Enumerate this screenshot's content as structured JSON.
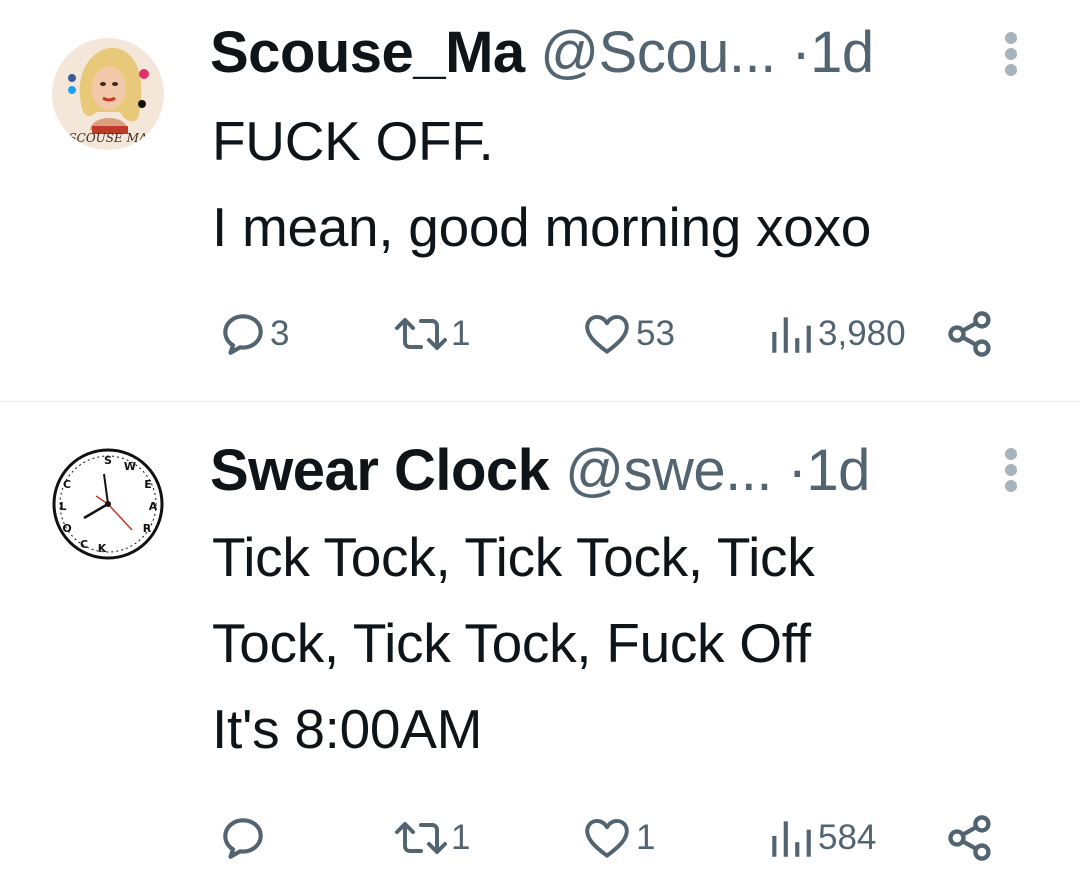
{
  "tweets": [
    {
      "name": "Scouse_Ma",
      "handle": "@Scou...",
      "separator": "·",
      "time": "1d",
      "avatar_text": "SCOUSE MA",
      "lines": [
        "FUCK OFF.",
        "I mean, good morning xoxo"
      ],
      "replies": "3",
      "retweets": "1",
      "likes": "53",
      "views": "3,980"
    },
    {
      "name": "Swear Clock",
      "handle": "@swe...",
      "separator": "·",
      "time": "1d",
      "avatar_letters": "SWEAR CLOCK",
      "lines": [
        "Tick Tock, Tick Tock, Tick",
        "Tock, Tick Tock, Fuck Off",
        "It's 8:00AM"
      ],
      "replies": "",
      "retweets": "1",
      "likes": "1",
      "views": "584"
    }
  ],
  "icons": {
    "reply": "reply-icon",
    "retweet": "retweet-icon",
    "like": "heart-icon",
    "views": "views-icon",
    "share": "share-icon",
    "more": "more-icon"
  },
  "colors": {
    "text": "#0f1419",
    "secondary": "#536471",
    "divider": "#e6e8ea"
  }
}
